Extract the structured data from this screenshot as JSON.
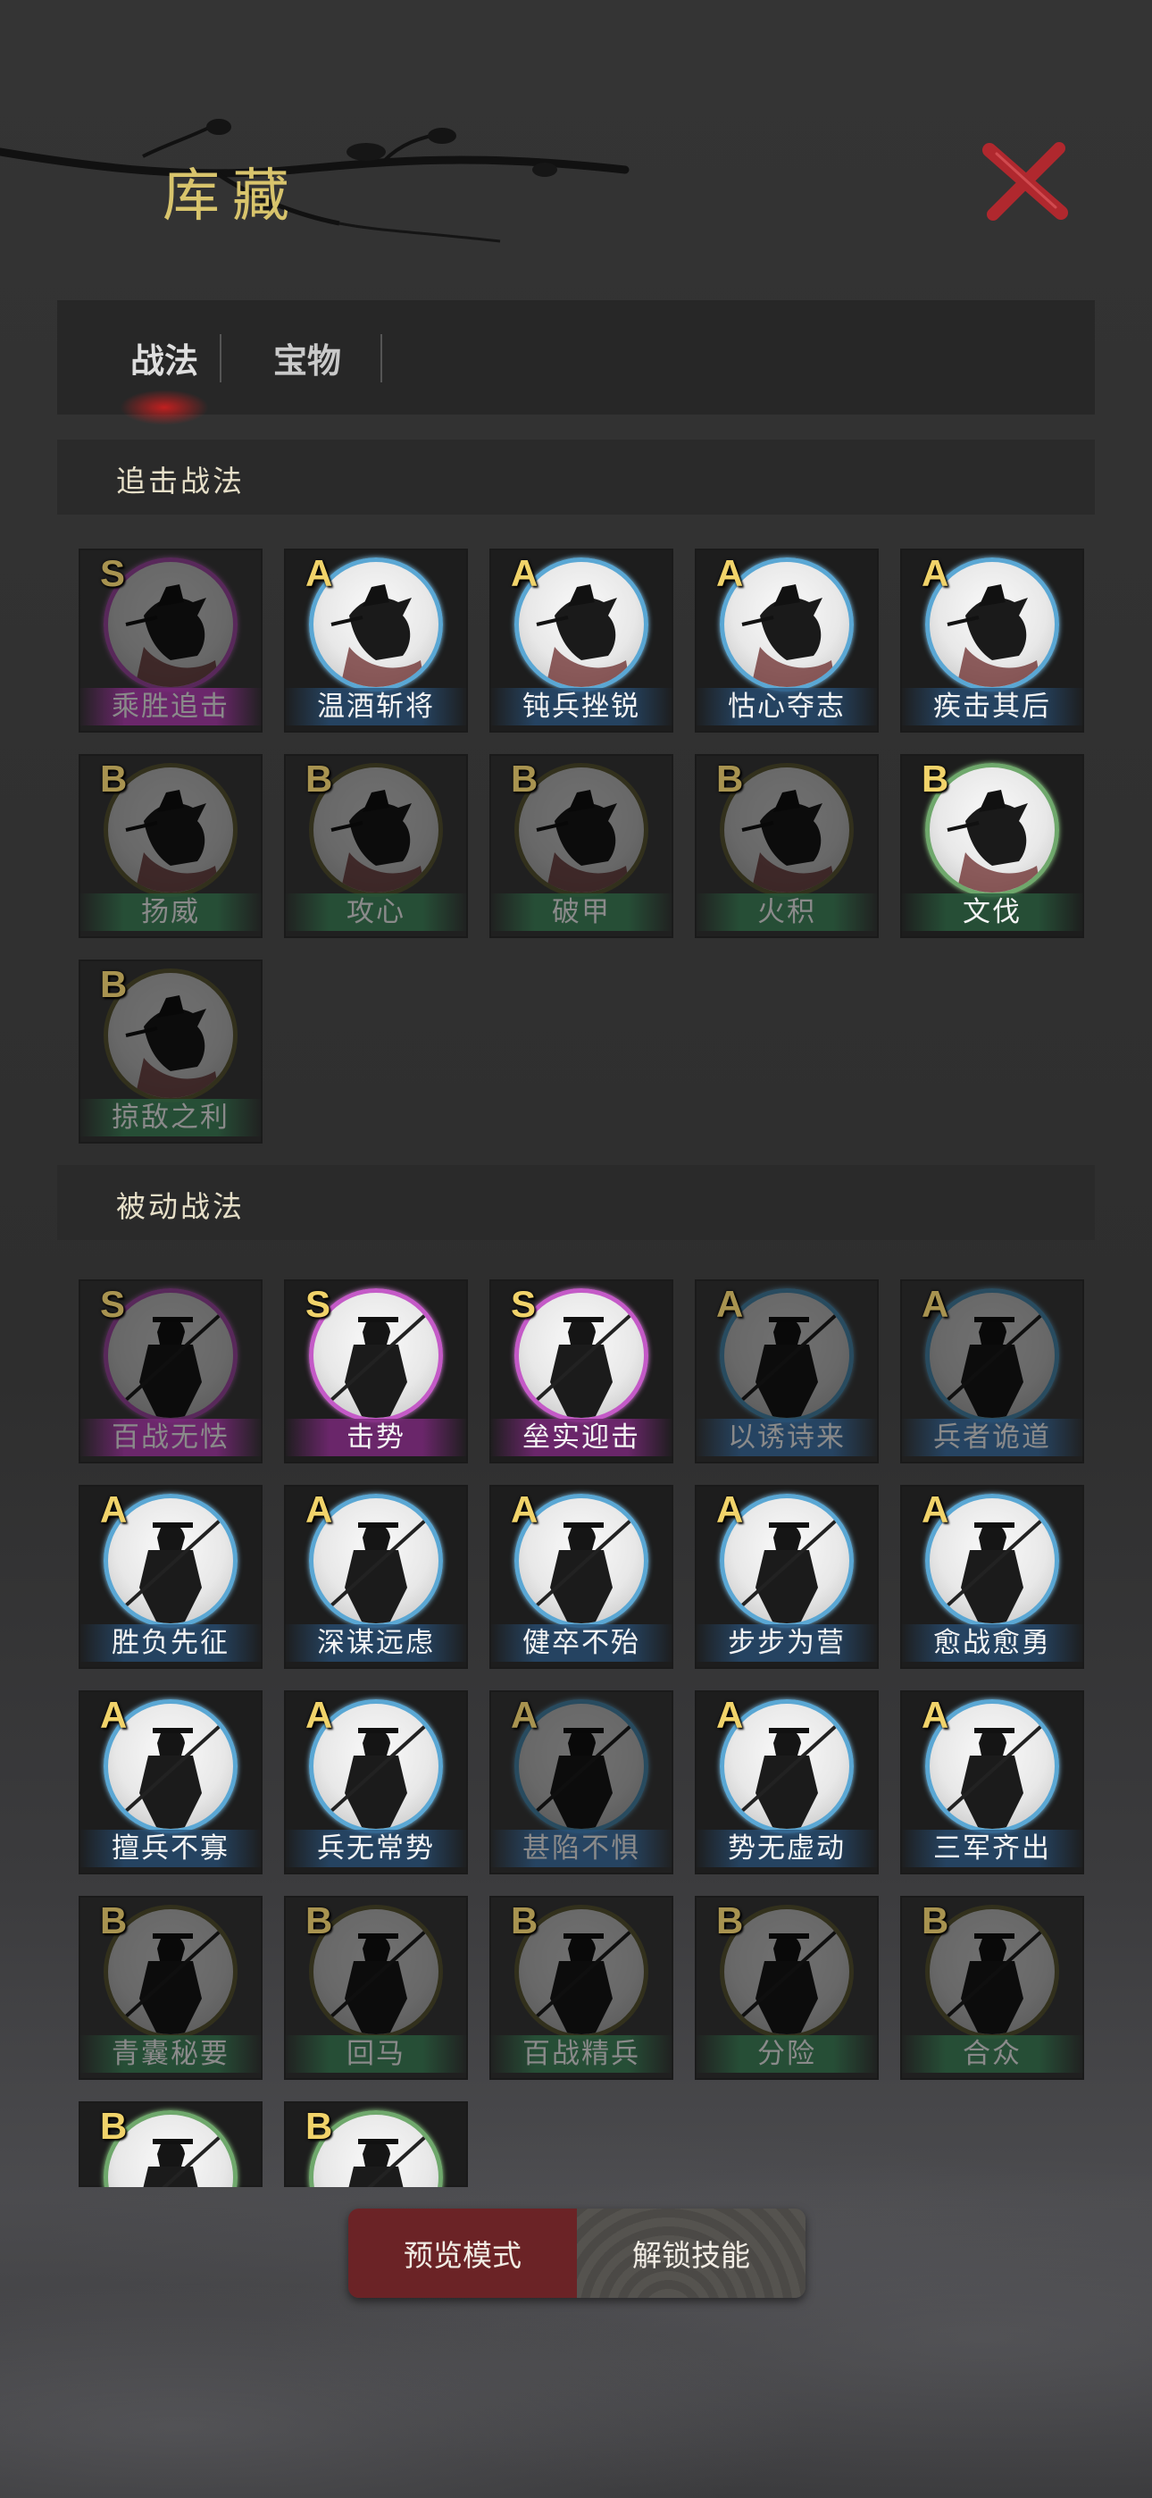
{
  "title": "库藏",
  "tabs": [
    {
      "label": "战法",
      "active": true
    },
    {
      "label": "宝物",
      "active": false
    }
  ],
  "sections": [
    {
      "title": "追击战法",
      "cards": [
        {
          "grade": "S",
          "name": "乘胜追击",
          "owned": false
        },
        {
          "grade": "A",
          "name": "温酒斩将",
          "owned": true
        },
        {
          "grade": "A",
          "name": "钝兵挫锐",
          "owned": true
        },
        {
          "grade": "A",
          "name": "怙心夺志",
          "owned": true
        },
        {
          "grade": "A",
          "name": "疾击其后",
          "owned": true
        },
        {
          "grade": "B",
          "name": "扬威",
          "owned": false
        },
        {
          "grade": "B",
          "name": "攻心",
          "owned": false
        },
        {
          "grade": "B",
          "name": "破甲",
          "owned": false
        },
        {
          "grade": "B",
          "name": "火积",
          "owned": false
        },
        {
          "grade": "B",
          "name": "文伐",
          "owned": true
        },
        {
          "grade": "B",
          "name": "掠敌之利",
          "owned": false
        }
      ]
    },
    {
      "title": "被动战法",
      "cards": [
        {
          "grade": "S",
          "name": "百战无怯",
          "owned": false
        },
        {
          "grade": "S",
          "name": "击势",
          "owned": true
        },
        {
          "grade": "S",
          "name": "垒实迎击",
          "owned": true
        },
        {
          "grade": "A",
          "name": "以诱诗来",
          "owned": false
        },
        {
          "grade": "A",
          "name": "兵者诡道",
          "owned": false
        },
        {
          "grade": "A",
          "name": "胜负先征",
          "owned": true
        },
        {
          "grade": "A",
          "name": "深谋远虑",
          "owned": true
        },
        {
          "grade": "A",
          "name": "健卒不殆",
          "owned": true
        },
        {
          "grade": "A",
          "name": "步步为营",
          "owned": true
        },
        {
          "grade": "A",
          "name": "愈战愈勇",
          "owned": true
        },
        {
          "grade": "A",
          "name": "擅兵不寡",
          "owned": true
        },
        {
          "grade": "A",
          "name": "兵无常势",
          "owned": true
        },
        {
          "grade": "A",
          "name": "甚陷不惧",
          "owned": false
        },
        {
          "grade": "A",
          "name": "势无虚动",
          "owned": true
        },
        {
          "grade": "A",
          "name": "三军齐出",
          "owned": true
        },
        {
          "grade": "B",
          "name": "青囊秘要",
          "owned": false
        },
        {
          "grade": "B",
          "name": "回马",
          "owned": false
        },
        {
          "grade": "B",
          "name": "百战精兵",
          "owned": false
        },
        {
          "grade": "B",
          "name": "分险",
          "owned": false
        },
        {
          "grade": "B",
          "name": "合众",
          "owned": false
        },
        {
          "grade": "B",
          "name": "",
          "owned": true
        },
        {
          "grade": "B",
          "name": "",
          "owned": true
        }
      ]
    }
  ],
  "buttons": {
    "preview": "预览模式",
    "unlock": "解锁技能"
  },
  "icons": {
    "close": "close-x-icon",
    "branch": "ink-branch-decoration",
    "chase_portrait": "horseman-portrait-icon",
    "passive_portrait": "spearman-portrait-icon"
  },
  "colors": {
    "grade_text": "#f1d36a",
    "ring_S": "#c45ac7",
    "ring_A": "#5aa7d4",
    "ring_B": "#6fa86c",
    "preview_button": "#6b2326",
    "title": "#d8c46c",
    "close": "#b0282e"
  }
}
